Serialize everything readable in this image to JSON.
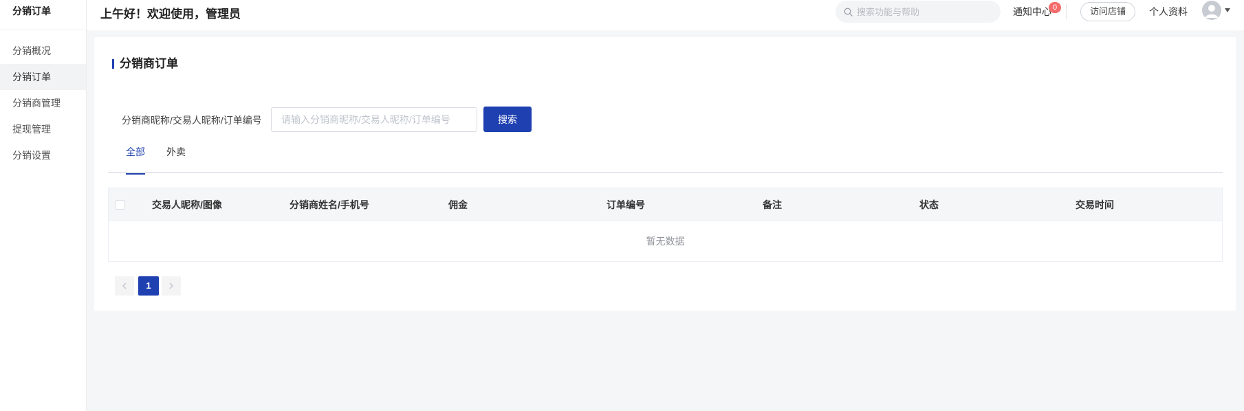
{
  "sidebar": {
    "title": "分销订单",
    "items": [
      {
        "label": "分销概况"
      },
      {
        "label": "分销订单"
      },
      {
        "label": "分销商管理"
      },
      {
        "label": "提现管理"
      },
      {
        "label": "分销设置"
      }
    ],
    "active_index": 1
  },
  "header": {
    "greeting": "上午好！欢迎使用，管理员",
    "search_placeholder": "搜索功能与帮助",
    "notify_label": "通知中心",
    "notify_count": "0",
    "visit_store_label": "访问店铺",
    "profile_label": "个人资料"
  },
  "main": {
    "title": "分销商订单",
    "filter": {
      "label": "分销商昵称/交易人昵称/订单编号",
      "placeholder": "请输入分销商昵称/交易人昵称/订单编号",
      "value": "",
      "search_label": "搜索"
    },
    "tabs": [
      {
        "label": "全部"
      },
      {
        "label": "外卖"
      }
    ],
    "active_tab": 0,
    "table": {
      "columns": [
        "交易人昵称/图像",
        "分销商姓名/手机号",
        "佣金",
        "订单编号",
        "备注",
        "状态",
        "交易时间"
      ],
      "rows": [],
      "empty_text": "暂无数据"
    },
    "pagination": {
      "current_page": "1"
    }
  },
  "colors": {
    "primary": "#1f40b0",
    "badge": "#f56c6c",
    "page_bg": "#f5f6f7"
  }
}
